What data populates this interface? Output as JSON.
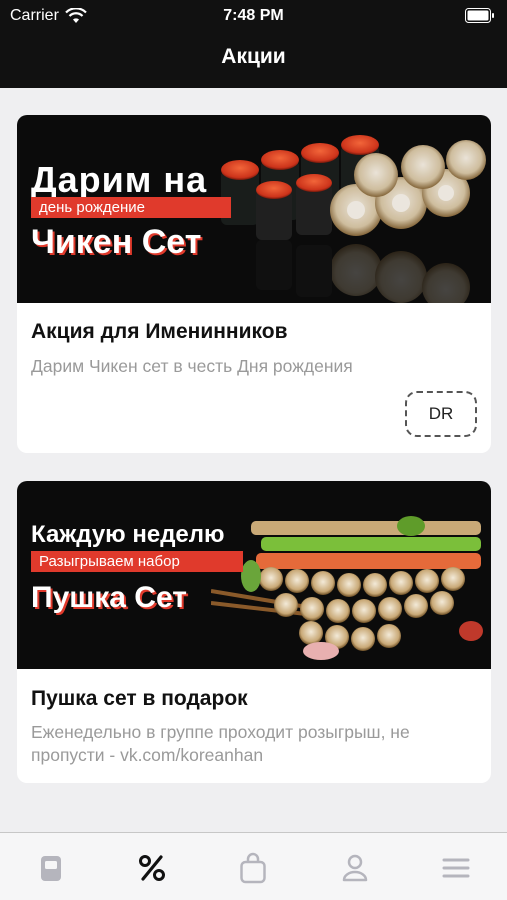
{
  "status_bar": {
    "carrier": "Carrier",
    "time": "7:48 PM"
  },
  "header": {
    "title": "Акции"
  },
  "promotions": [
    {
      "banner": {
        "line1": "Дарим на",
        "tag": "день рождение",
        "big": "Чикен Сет"
      },
      "title": "Акция для Именинников",
      "description": "Дарим Чикен сет в честь Дня рождения",
      "promo_code": "DR"
    },
    {
      "banner": {
        "line1": "Каждую неделю",
        "tag": "Разыгрываем набор",
        "big": "Пушка Сет"
      },
      "title": "Пушка сет в подарок",
      "description": "Еженедельно в группе проходит розыгрыш, не пропусти - vk.com/koreanhan"
    }
  ],
  "tabbar": {
    "items": [
      {
        "icon": "menu-book-icon",
        "active": false
      },
      {
        "icon": "percent-icon",
        "active": true
      },
      {
        "icon": "shopping-bag-icon",
        "active": false
      },
      {
        "icon": "profile-icon",
        "active": false
      },
      {
        "icon": "hamburger-menu-icon",
        "active": false
      }
    ]
  },
  "colors": {
    "header_bg": "#111111",
    "accent_red": "#e03a2c",
    "inactive_icon": "#b5b5bd",
    "active_icon": "#111111"
  }
}
